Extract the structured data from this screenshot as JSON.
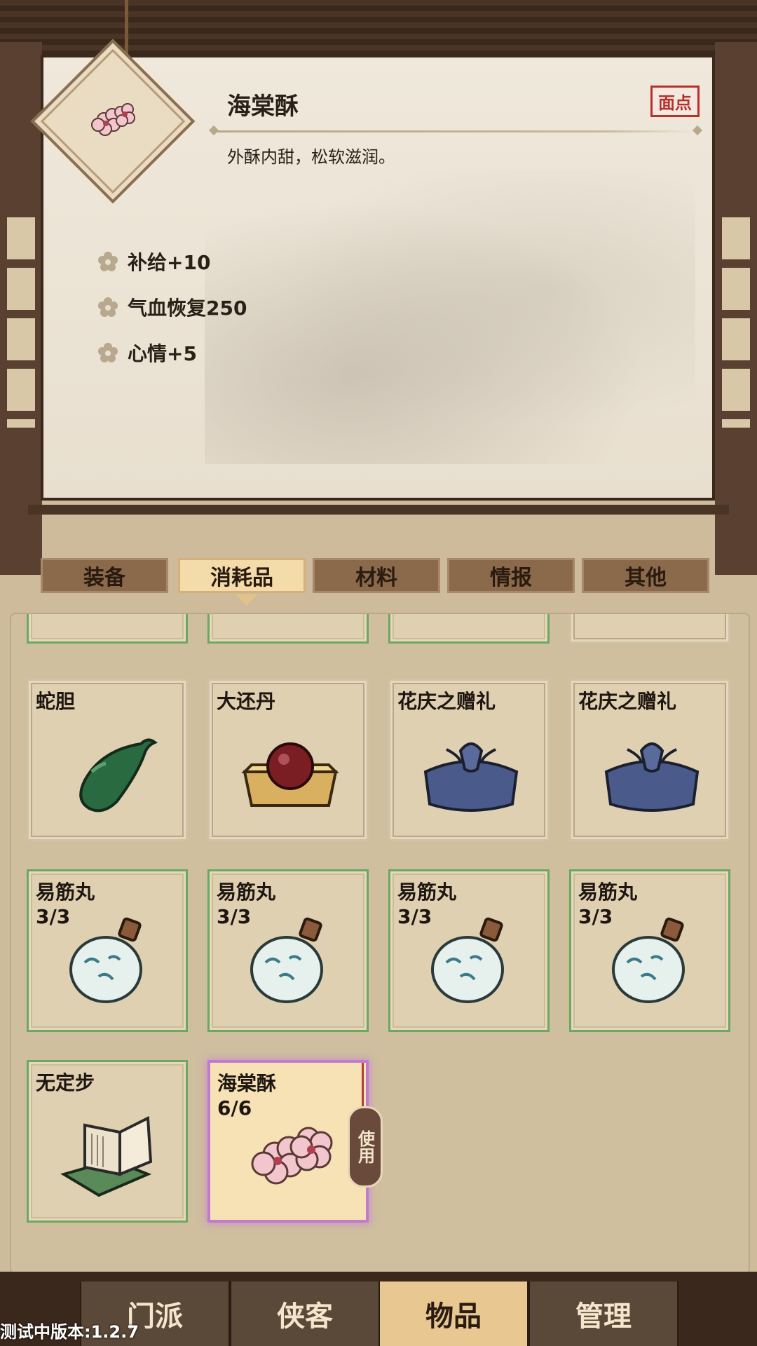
{
  "detail": {
    "name": "海棠酥",
    "tag": "面点",
    "description": "外酥内甜，松软滋润。",
    "icon": "begonia-flower-icon",
    "stats": [
      {
        "icon": "flower-bullet-icon",
        "label": "补给+10"
      },
      {
        "icon": "flower-bullet-icon",
        "label": "气血恢复250"
      },
      {
        "icon": "flower-bullet-icon",
        "label": "心情+5"
      }
    ]
  },
  "tabs": [
    {
      "label": "装备",
      "active": false
    },
    {
      "label": "消耗品",
      "active": true
    },
    {
      "label": "材料",
      "active": false
    },
    {
      "label": "情报",
      "active": false
    },
    {
      "label": "其他",
      "active": false
    }
  ],
  "items": [
    {
      "name": "蛇胆",
      "count": "",
      "icon": "snake-gallbladder-icon"
    },
    {
      "name": "大还丹",
      "count": "",
      "icon": "pill-box-icon"
    },
    {
      "name": "花庆之赠礼",
      "count": "",
      "icon": "cloth-bundle-icon"
    },
    {
      "name": "花庆之赠礼",
      "count": "",
      "icon": "cloth-bundle-icon"
    },
    {
      "name": "易筋丸",
      "count": "3/3",
      "icon": "porcelain-bottle-icon"
    },
    {
      "name": "易筋丸",
      "count": "3/3",
      "icon": "porcelain-bottle-icon"
    },
    {
      "name": "易筋丸",
      "count": "3/3",
      "icon": "porcelain-bottle-icon"
    },
    {
      "name": "易筋丸",
      "count": "3/3",
      "icon": "porcelain-bottle-icon"
    },
    {
      "name": "无定步",
      "count": "",
      "icon": "book-scroll-icon"
    },
    {
      "name": "海棠酥",
      "count": "6/6",
      "icon": "begonia-flower-icon",
      "selected": true
    }
  ],
  "use_label": "使用",
  "nav": [
    {
      "label": "门派",
      "active": false
    },
    {
      "label": "侠客",
      "active": false
    },
    {
      "label": "物品",
      "active": true
    },
    {
      "label": "管理",
      "active": false
    }
  ],
  "version": "测试中版本:1.2.7",
  "colors": {
    "panel_bg": "#efe8db",
    "frame_wood": "#3a281c",
    "tab_active": "#f3dcaa",
    "cell_border_green": "#6ca860",
    "selected_glow": "#c07ad0",
    "tag_red": "#b8302a"
  }
}
